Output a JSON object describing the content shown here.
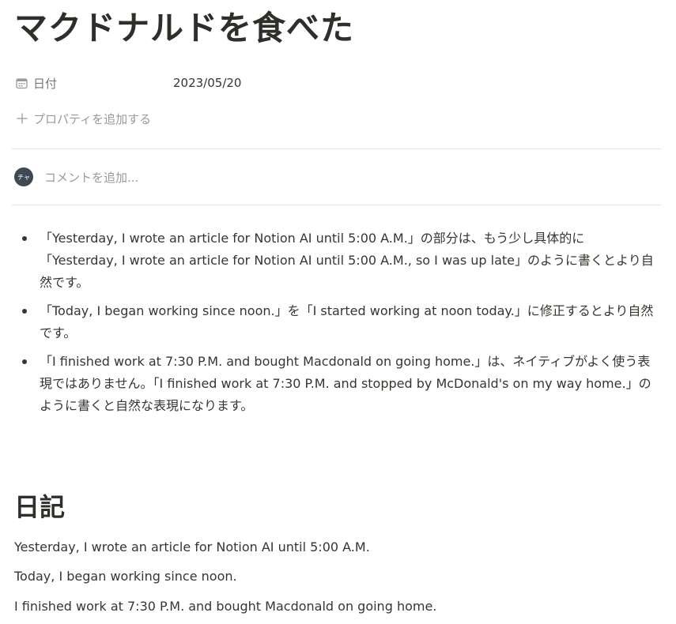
{
  "page": {
    "title": "マクドナルドを食べた"
  },
  "properties": {
    "date": {
      "icon": "calendar-icon",
      "name": "日付",
      "value": "2023/05/20"
    },
    "add_property": {
      "icon": "plus-icon",
      "label": "プロパティを追加する"
    }
  },
  "comment": {
    "avatar_text": "チャ",
    "placeholder": "コメントを追加..."
  },
  "feedback": {
    "items": [
      "「Yesterday, I wrote an article for Notion AI until 5:00 A.M.」の部分は、もう少し具体的に「Yesterday, I wrote an article for Notion AI until 5:00 A.M., so I was up late」のように書くとより自然です。",
      "「Today, I began working since noon.」を「I started working at noon today.」に修正するとより自然です。",
      "「I finished work at 7:30 P.M. and bought Macdonald on going home.」は、ネイティブがよく使う表現ではありません。「I finished work at 7:30 P.M. and stopped by McDonald's on my way home.」のように書くと自然な表現になります。"
    ]
  },
  "diary": {
    "heading": "日記",
    "lines": [
      "Yesterday, I wrote an article for Notion AI until 5:00 A.M.",
      "Today, I began working since noon.",
      "I finished work at 7:30 P.M. and bought Macdonald on going home."
    ]
  }
}
